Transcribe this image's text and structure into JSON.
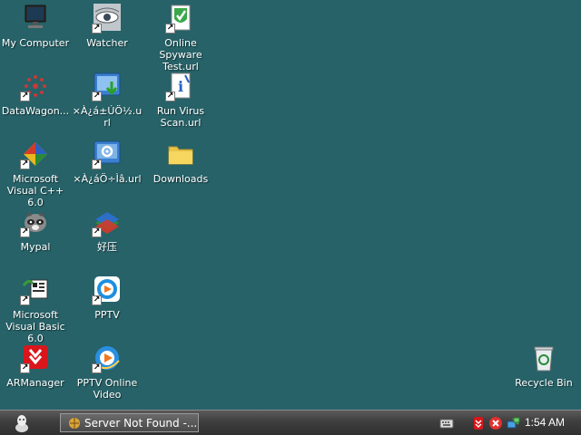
{
  "desktop": {
    "icons": [
      {
        "label": "My Computer",
        "icon": "my-computer-icon"
      },
      {
        "label": "Watcher",
        "icon": "watcher-icon"
      },
      {
        "label": "Online Spyware Test.url",
        "icon": "shield-check-icon"
      },
      {
        "label": "DataWagon...",
        "icon": "datawagon-icon"
      },
      {
        "label": "×À¿á±ÚÖ½.url",
        "icon": "download-monitor-icon"
      },
      {
        "label": "Run Virus Scan.url",
        "icon": "virus-scan-icon"
      },
      {
        "label": "Microsoft Visual C++ 6.0",
        "icon": "visual-cpp-icon"
      },
      {
        "label": "×À¿áÖ÷Ìâ.url",
        "icon": "settings-monitor-icon"
      },
      {
        "label": "Downloads",
        "icon": "folder-icon"
      },
      {
        "label": "Mypal",
        "icon": "raccoon-icon"
      },
      {
        "label": "好压",
        "icon": "archive-books-icon"
      },
      {
        "label": "Microsoft Visual Basic 6.0",
        "icon": "visual-basic-icon"
      },
      {
        "label": "PPTV",
        "icon": "pptv-icon"
      },
      {
        "label": "ARManager",
        "icon": "armanager-icon"
      },
      {
        "label": "PPTV Online Video",
        "icon": "pptv-online-icon"
      },
      {
        "label": "Recycle Bin",
        "icon": "recycle-bin-icon"
      }
    ]
  },
  "taskbar": {
    "start_icon": "start-icon",
    "task_label": "Server Not Found -...",
    "tray_icons": [
      "keyboard-icon",
      "antivirus-icon",
      "close-circle-icon",
      "network-icon"
    ],
    "clock": "1:54 AM"
  },
  "colors": {
    "desktop_bg": "#266268",
    "taskbar_bg": "#3e3e3e"
  }
}
